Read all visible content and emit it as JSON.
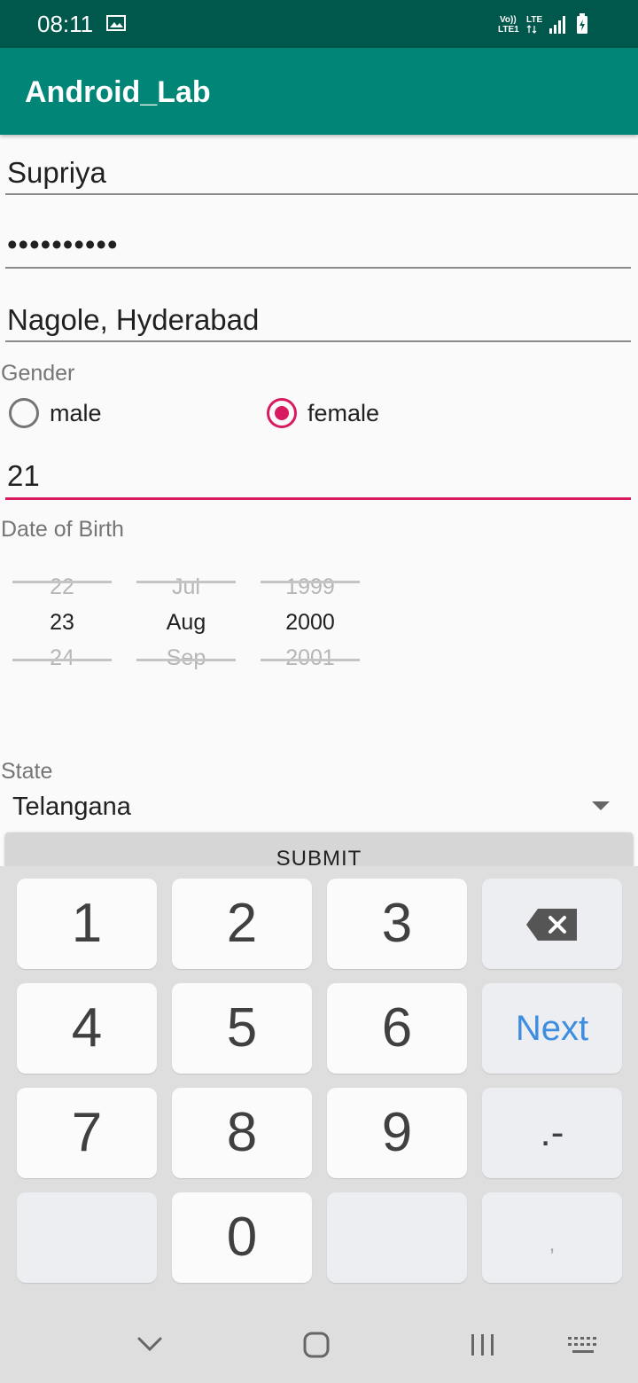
{
  "status_bar": {
    "time": "08:11",
    "icons": [
      "image-icon",
      "volte-icon",
      "lte-icon",
      "signal-icon",
      "battery-icon"
    ],
    "volte_text": "Vo)) LTE1",
    "lte_text": "LTE"
  },
  "app_bar": {
    "title": "Android_Lab"
  },
  "form": {
    "name_value": "Supriya",
    "password_value": "••••••••••",
    "address_value": "Nagole, Hyderabad",
    "gender_label": "Gender",
    "gender_options": [
      {
        "label": "male",
        "checked": false
      },
      {
        "label": "female",
        "checked": true
      }
    ],
    "age_value": "21",
    "dob_label": "Date of Birth",
    "date_picker": {
      "day": {
        "prev": "22",
        "selected": "23",
        "next": "24"
      },
      "month": {
        "prev": "Jul",
        "selected": "Aug",
        "next": "Sep"
      },
      "year": {
        "prev": "1999",
        "selected": "2000",
        "next": "2001"
      }
    },
    "state_label": "State",
    "state_value": "Telangana",
    "submit_label": "SUBMIT"
  },
  "keyboard": {
    "keys": [
      "1",
      "2",
      "3",
      "4",
      "5",
      "6",
      "7",
      "8",
      "9",
      "0"
    ],
    "next_label": "Next",
    "dash_label": ".-",
    "comma_label": ","
  },
  "colors": {
    "status_bar": "#00574b",
    "app_bar": "#008577",
    "accent": "#d81b60",
    "keyboard_bg": "#dedede",
    "next_key": "#3d8de0"
  }
}
